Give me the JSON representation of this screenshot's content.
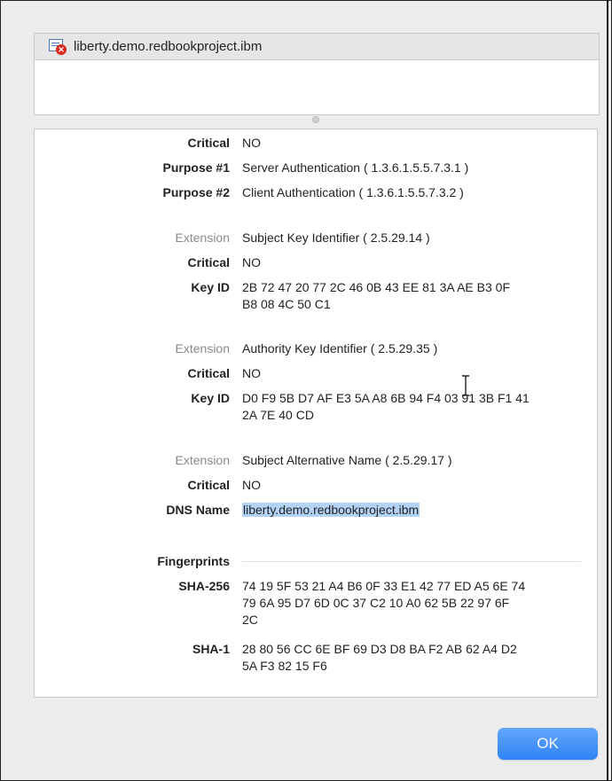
{
  "header": {
    "title": "liberty.demo.redbookproject.ibm",
    "icon": "certificate-error-icon"
  },
  "details": {
    "purpose": {
      "critical_label": "Critical",
      "critical_value": "NO",
      "p1_label": "Purpose #1",
      "p1_value": "Server Authentication ( 1.3.6.1.5.5.7.3.1 )",
      "p2_label": "Purpose #2",
      "p2_value": "Client Authentication ( 1.3.6.1.5.5.7.3.2 )"
    },
    "ski": {
      "ext_label": "Extension",
      "ext_value": "Subject Key Identifier ( 2.5.29.14 )",
      "critical_label": "Critical",
      "critical_value": "NO",
      "key_label": "Key ID",
      "key_line1": "2B 72 47 20 77 2C 46 0B 43 EE 81 3A AE B3 0F",
      "key_line2": "B8 08 4C 50 C1"
    },
    "aki": {
      "ext_label": "Extension",
      "ext_value": "Authority Key Identifier ( 2.5.29.35 )",
      "critical_label": "Critical",
      "critical_value": "NO",
      "key_label": "Key ID",
      "key_line1": "D0 F9 5B D7 AF E3 5A A8 6B 94 F4 03 91 3B F1 41",
      "key_line2": "2A 7E 40 CD"
    },
    "san": {
      "ext_label": "Extension",
      "ext_value": "Subject Alternative Name ( 2.5.29.17 )",
      "critical_label": "Critical",
      "critical_value": "NO",
      "dns_label": "DNS Name",
      "dns_value": "liberty.demo.redbookproject.ibm"
    },
    "fingerprints": {
      "label": "Fingerprints",
      "sha256_label": "SHA-256",
      "sha256_line1": "74 19 5F 53 21 A4 B6 0F 33 E1 42 77 ED A5 6E 74",
      "sha256_line2": "79 6A 95 D7 6D 0C 37 C2 10 A0 62 5B 22 97 6F",
      "sha256_line3": "2C",
      "sha1_label": "SHA-1",
      "sha1_line1": "28 80 56 CC 6E BF 69 D3 D8 BA F2 AB 62 A4 D2",
      "sha1_line2": "5A F3 82 15 F6"
    }
  },
  "buttons": {
    "ok_label": "OK"
  },
  "colors": {
    "accent": "#3b8ef7",
    "selection": "#b3d3f6",
    "error": "#d9291c"
  }
}
